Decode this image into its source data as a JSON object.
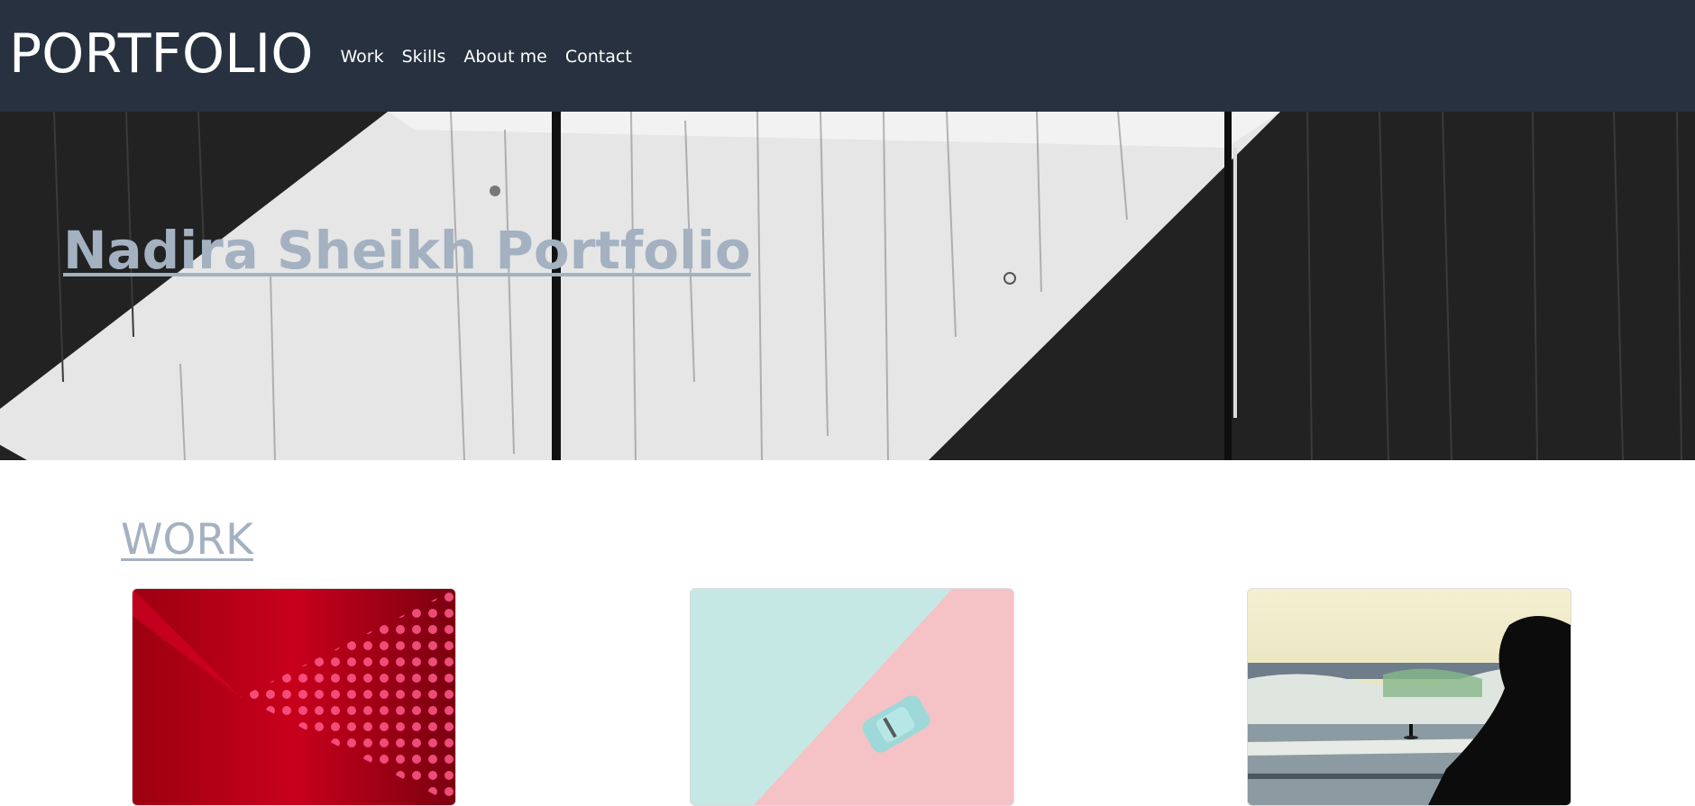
{
  "navbar": {
    "brand": "PORTFOLIO",
    "links": [
      "Work",
      "Skills",
      "About me",
      "Contact"
    ]
  },
  "hero": {
    "title": "Nadira Sheikh Portfolio"
  },
  "work": {
    "heading": "WORK",
    "cards": [
      {
        "image": "red-led-wall-image"
      },
      {
        "image": "toy-car-on-pastel-image"
      },
      {
        "image": "surfer-sunset-image"
      }
    ]
  },
  "colors": {
    "navbar_bg": "#27313f",
    "heading_accent": "#a3b1c1"
  }
}
